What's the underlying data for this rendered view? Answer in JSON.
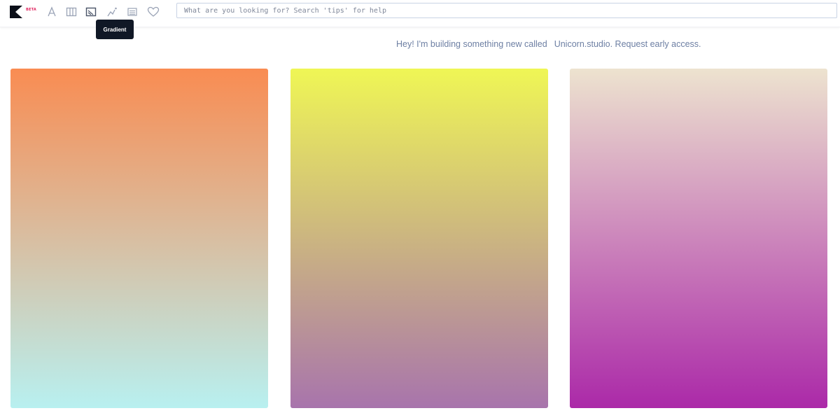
{
  "header": {
    "beta_label": "BETA",
    "tools": [
      {
        "icon": "font-icon"
      },
      {
        "icon": "columns-icon"
      },
      {
        "icon": "gradient-icon"
      },
      {
        "icon": "sparkle-chart-icon"
      },
      {
        "icon": "list-icon"
      },
      {
        "icon": "heart-icon"
      }
    ],
    "search": {
      "placeholder": "What are you looking for? Search 'tips' for help",
      "value": ""
    },
    "tooltip": "Gradient"
  },
  "banner": {
    "text": "Hey! I'm building something new called",
    "link": "Unicorn.studio. Request early access."
  },
  "colors": {
    "icon": "#9aa3b6",
    "banner_text": "#6d7fa3",
    "tooltip_bg": "#101826"
  },
  "gradients": [
    {
      "from": "#f98c52",
      "to": "#b8f0f0"
    },
    {
      "from": "#eff655",
      "to": "#a874ac"
    },
    {
      "from": "#ede3cf",
      "to": "#ab29a8"
    }
  ]
}
